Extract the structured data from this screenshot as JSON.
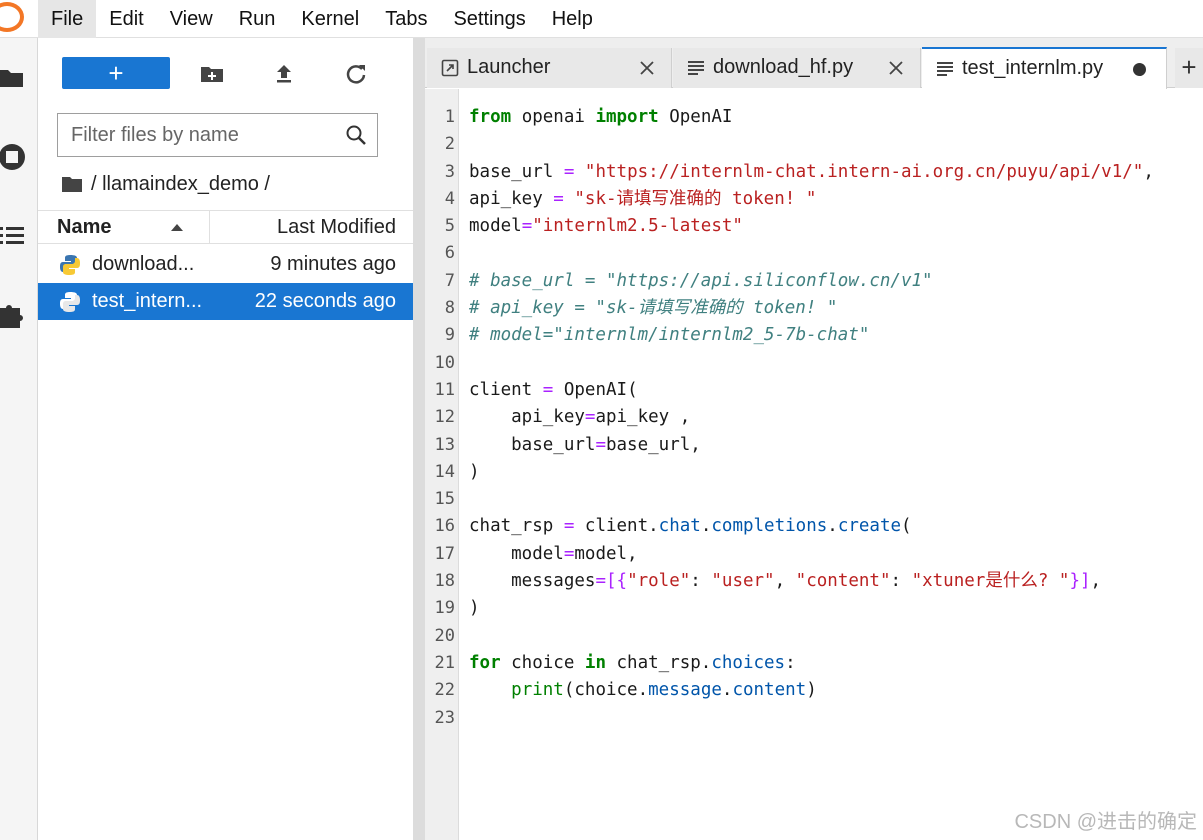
{
  "menubar": {
    "items": [
      "File",
      "Edit",
      "View",
      "Run",
      "Kernel",
      "Tabs",
      "Settings",
      "Help"
    ],
    "active": "File"
  },
  "activitybar": {
    "icons": [
      "folder-icon",
      "stop-circle-icon",
      "list-icon",
      "puzzle-icon"
    ]
  },
  "filebrowser": {
    "new_label": "+",
    "filter_placeholder": "Filter files by name",
    "breadcrumb": "/ llamaindex_demo /",
    "columns": {
      "name": "Name",
      "modified": "Last Modified"
    },
    "files": [
      {
        "name": "download...",
        "modified": "9 minutes ago",
        "selected": false
      },
      {
        "name": "test_intern...",
        "modified": "22 seconds ago",
        "selected": true
      }
    ]
  },
  "tabs": [
    {
      "label": "Launcher",
      "icon": "launcher-icon",
      "active": false,
      "dirty": false
    },
    {
      "label": "download_hf.py",
      "icon": "text-file-icon",
      "active": false,
      "dirty": false
    },
    {
      "label": "test_internlm.py",
      "icon": "text-file-icon",
      "active": true,
      "dirty": true
    }
  ],
  "add_tab_label": "+",
  "code": {
    "lines": [
      "from openai import OpenAI",
      "",
      "base_url = \"https://internlm-chat.intern-ai.org.cn/puyu/api/v1/\",",
      "api_key = \"sk-请填写准确的 token! \"",
      "model=\"internlm2.5-latest\"",
      "",
      "# base_url = \"https://api.siliconflow.cn/v1\"",
      "# api_key = \"sk-请填写准确的 token! \"",
      "# model=\"internlm/internlm2_5-7b-chat\"",
      "",
      "client = OpenAI(",
      "    api_key=api_key ,",
      "    base_url=base_url,",
      ")",
      "",
      "chat_rsp = client.chat.completions.create(",
      "    model=model,",
      "    messages=[{\"role\": \"user\", \"content\": \"xtuner是什么? \"}],",
      ")",
      "",
      "for choice in chat_rsp.choices:",
      "    print(choice.message.content)",
      ""
    ]
  },
  "watermark": "CSDN @进击的确定",
  "colors": {
    "accent": "#1976d2",
    "keyword": "#008000",
    "string": "#ba2121",
    "comment": "#408080",
    "operator": "#aa22ff",
    "logo": "#f37726"
  }
}
